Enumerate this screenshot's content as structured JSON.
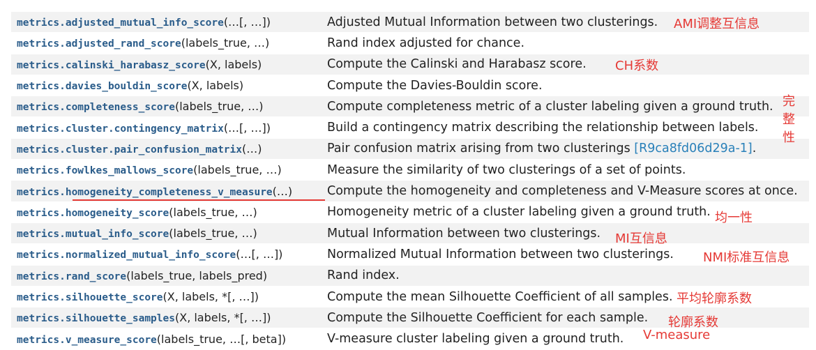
{
  "rows": [
    {
      "name": "metrics.adjusted_mutual_info_score",
      "sig": "(…[, …])",
      "desc": "Adjusted Mutual Information between two clusterings."
    },
    {
      "name": "metrics.adjusted_rand_score",
      "sig": "(labels_true, …)",
      "desc": "Rand index adjusted for chance."
    },
    {
      "name": "metrics.calinski_harabasz_score",
      "sig": "(X, labels)",
      "desc": "Compute the Calinski and Harabasz score."
    },
    {
      "name": "metrics.davies_bouldin_score",
      "sig": "(X, labels)",
      "desc": "Compute the Davies-Bouldin score."
    },
    {
      "name": "metrics.completeness_score",
      "sig": "(labels_true, …)",
      "desc": "Compute completeness metric of a cluster labeling given a ground truth."
    },
    {
      "name": "metrics.cluster.contingency_matrix",
      "sig": "(…[, …])",
      "desc": "Build a contingency matrix describing the relationship between labels."
    },
    {
      "name": "metrics.cluster.pair_confusion_matrix",
      "sig": "(…)",
      "desc": "Pair confusion matrix arising from two clusterings ",
      "ref": "[R9ca8fd06d29a-1]",
      "desc_tail": "."
    },
    {
      "name": "metrics.fowlkes_mallows_score",
      "sig": "(labels_true, …)",
      "desc": "Measure the similarity of two clusterings of a set of points."
    },
    {
      "name": "metrics.homogeneity_completeness_v_measure",
      "sig": "(…)",
      "desc": "Compute the homogeneity and completeness and V-Measure scores at once."
    },
    {
      "name": "metrics.homogeneity_score",
      "sig": "(labels_true, …)",
      "desc": "Homogeneity metric of a cluster labeling given a ground truth."
    },
    {
      "name": "metrics.mutual_info_score",
      "sig": "(labels_true, …)",
      "desc": "Mutual Information between two clusterings."
    },
    {
      "name": "metrics.normalized_mutual_info_score",
      "sig": "(…[, …])",
      "desc": "Normalized Mutual Information between two clusterings."
    },
    {
      "name": "metrics.rand_score",
      "sig": "(labels_true, labels_pred)",
      "desc": "Rand index."
    },
    {
      "name": "metrics.silhouette_score",
      "sig": "(X, labels, *[, …])",
      "desc": "Compute the mean Silhouette Coefficient of all samples."
    },
    {
      "name": "metrics.silhouette_samples",
      "sig": "(X, labels, *[, …])",
      "desc": "Compute the Silhouette Coefficient for each sample."
    },
    {
      "name": "metrics.v_measure_score",
      "sig": "(labels_true, …[, beta])",
      "desc": "V-measure cluster labeling given a ground truth."
    }
  ],
  "annotations": {
    "ami": "AMI调整互信息",
    "ch": "CH系数",
    "completeness": "完整性",
    "homogeneity": "均一性",
    "mi": "MI互信息",
    "nmi": "NMI标准互信息",
    "silhouette_mean": "平均轮廓系数",
    "silhouette": "轮廓系数",
    "v_measure": "V-measure"
  },
  "colors": {
    "link": "#2a5c8a",
    "annotation": "#e53935",
    "row_alt": "#f2f2f2"
  }
}
